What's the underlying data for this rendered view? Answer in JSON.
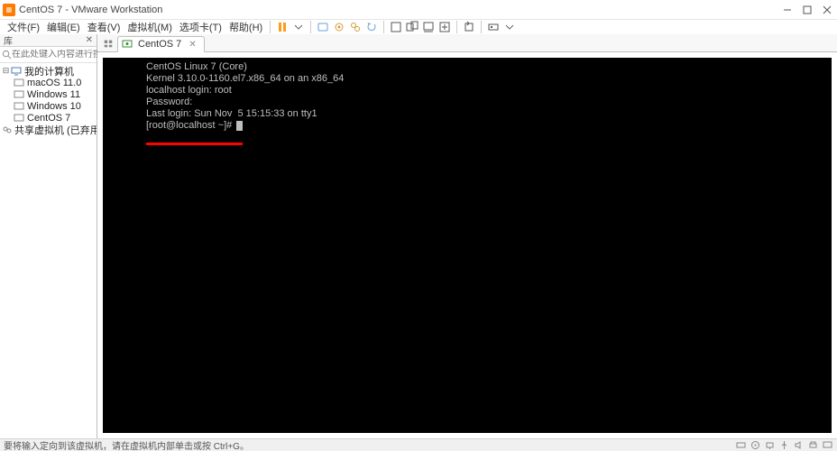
{
  "window": {
    "title": "CentOS 7 - VMware Workstation"
  },
  "menu": {
    "file": "文件(F)",
    "edit": "编辑(E)",
    "view": "查看(V)",
    "vm": "虚拟机(M)",
    "tabs": "选项卡(T)",
    "help": "帮助(H)"
  },
  "sidebar": {
    "header": "库",
    "search_placeholder": "在此处键入内容进行搜索",
    "root": "我的计算机",
    "items": [
      "macOS 11.0",
      "Windows 11",
      "Windows 10",
      "CentOS 7"
    ],
    "shared": "共享虚拟机 (已弃用)"
  },
  "tab": {
    "label": "CentOS 7"
  },
  "console": {
    "l1": "CentOS Linux 7 (Core)",
    "l2": "Kernel 3.10.0-1160.el7.x86_64 on an x86_64",
    "l3": "",
    "l4": "localhost login: root",
    "l5": "Password:",
    "l6": "Last login: Sun Nov  5 15:15:33 on tty1",
    "l7": "[root@localhost ~]# "
  },
  "status": {
    "text": "要将输入定向到该虚拟机，请在虚拟机内部单击或按 Ctrl+G。"
  }
}
